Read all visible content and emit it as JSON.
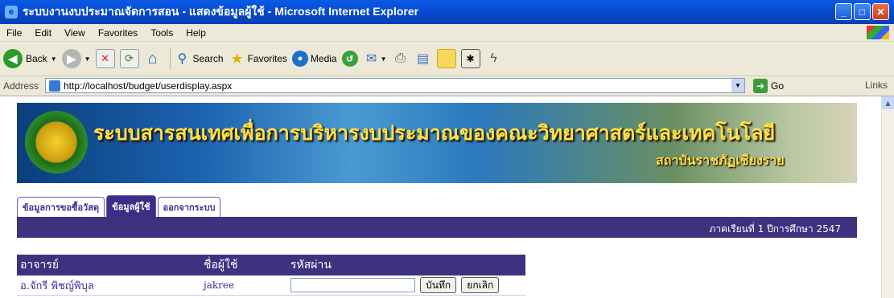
{
  "window": {
    "title": "ระบบงานงบประมาณจัดการสอน - แสดงข้อมูลผู้ใช้ - Microsoft Internet Explorer"
  },
  "menu": {
    "file": "File",
    "edit": "Edit",
    "view": "View",
    "favorites": "Favorites",
    "tools": "Tools",
    "help": "Help"
  },
  "toolbar": {
    "back": "Back",
    "search": "Search",
    "favorites": "Favorites",
    "media": "Media"
  },
  "address": {
    "label": "Address",
    "url": "http://localhost/budget/userdisplay.aspx",
    "go": "Go",
    "links": "Links"
  },
  "banner": {
    "title": "ระบบสารสนเทศเพื่อการบริหารงบประมาณของคณะวิทยาศาสตร์และเทคโนโลยี",
    "subtitle": "สถาบันราชภัฏเชียงราย"
  },
  "tabs": [
    {
      "label": "ข้อมูลการขอซื้อวัสดุ",
      "active": false
    },
    {
      "label": "ข้อมูลผู้ใช้",
      "active": true
    },
    {
      "label": "ออกจากระบบ",
      "active": false
    }
  ],
  "semester": "ภาคเรียนที่ 1 ปีการศึกษา 2547",
  "user_table": {
    "headers": [
      "อาจารย์",
      "ชื่อผู้ใช้",
      "รหัสผ่าน"
    ],
    "rows": [
      {
        "teacher": "อ.จักรี พิชญ์พิบุล",
        "username": "jakree",
        "password": ""
      }
    ],
    "save": "บันทึก",
    "cancel": "ยกเลิก"
  }
}
